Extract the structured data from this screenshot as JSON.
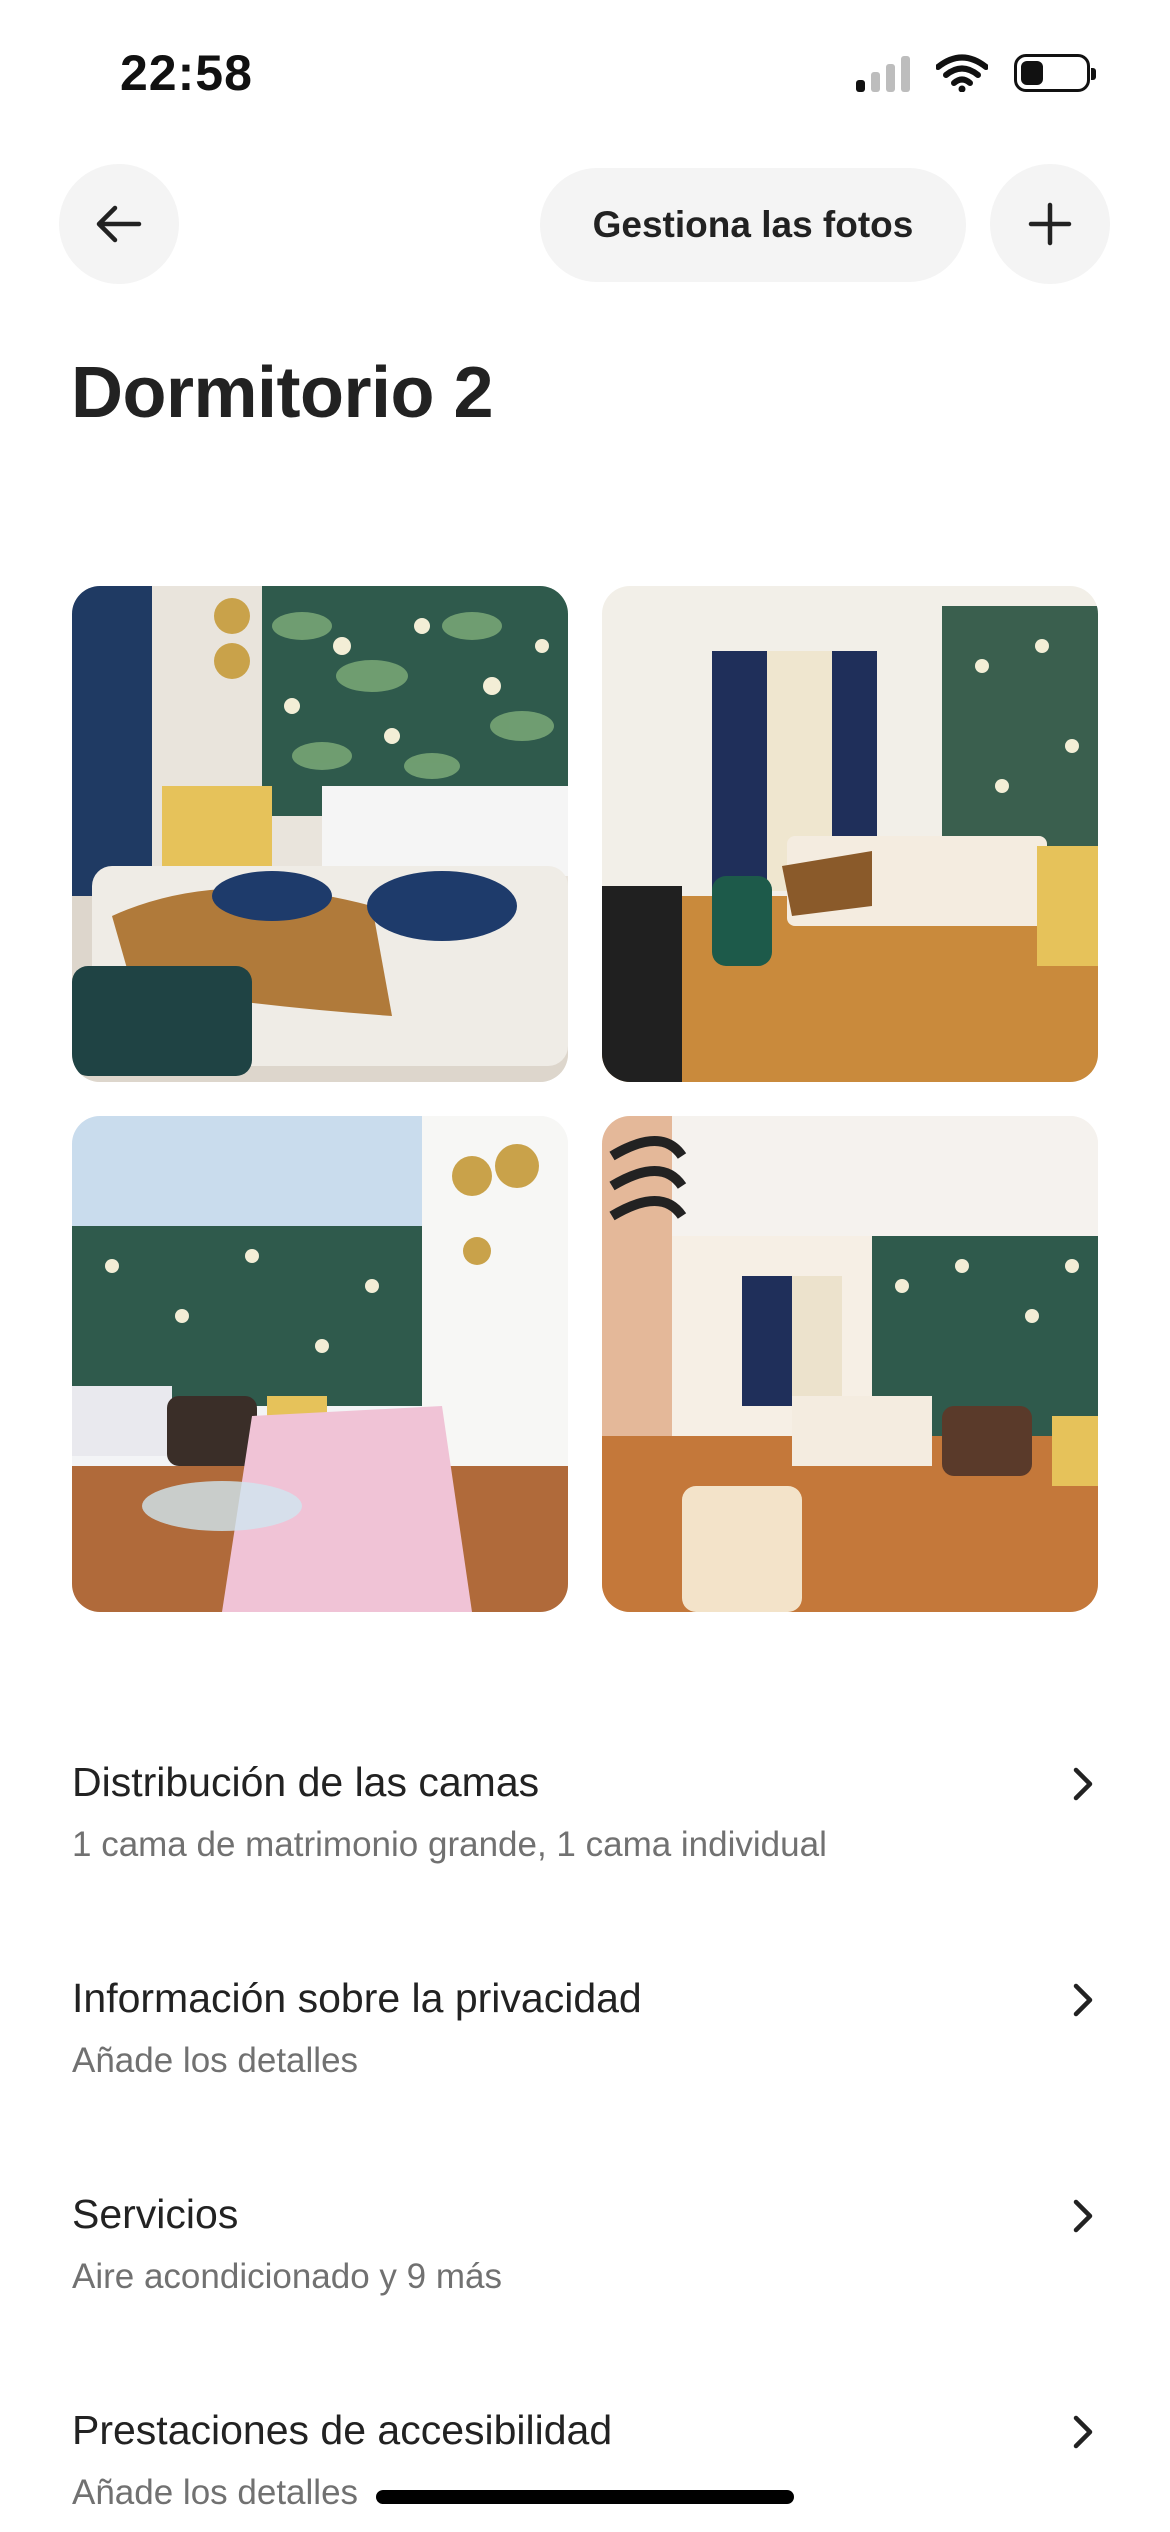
{
  "status_bar": {
    "time": "22:58",
    "icons": [
      "cellular-signal-icon",
      "wifi-icon",
      "battery-icon"
    ]
  },
  "top_nav": {
    "back_icon": "arrow-left-icon",
    "manage_photos_label": "Gestiona las fotos",
    "add_icon": "plus-icon"
  },
  "page_title": "Dormitorio 2",
  "photos": [
    {
      "subject": "bed-with-tropical-wallpaper"
    },
    {
      "subject": "bedroom-with-curtains-and-green-chair"
    },
    {
      "subject": "living-area-with-pink-sofa-bed"
    },
    {
      "subject": "room-overview-with-armchair"
    }
  ],
  "details": [
    {
      "title": "Distribución de las camas",
      "subtitle": "1 cama de matrimonio grande, 1 cama individual"
    },
    {
      "title": "Información sobre la privacidad",
      "subtitle": "Añade los detalles"
    },
    {
      "title": "Servicios",
      "subtitle": "Aire acondicionado y 9 más"
    },
    {
      "title": "Prestaciones de accesibilidad",
      "subtitle": "Añade los detalles"
    }
  ],
  "colors": {
    "text": "#222222",
    "muted": "#717171",
    "button_bg": "#f4f4f4"
  }
}
